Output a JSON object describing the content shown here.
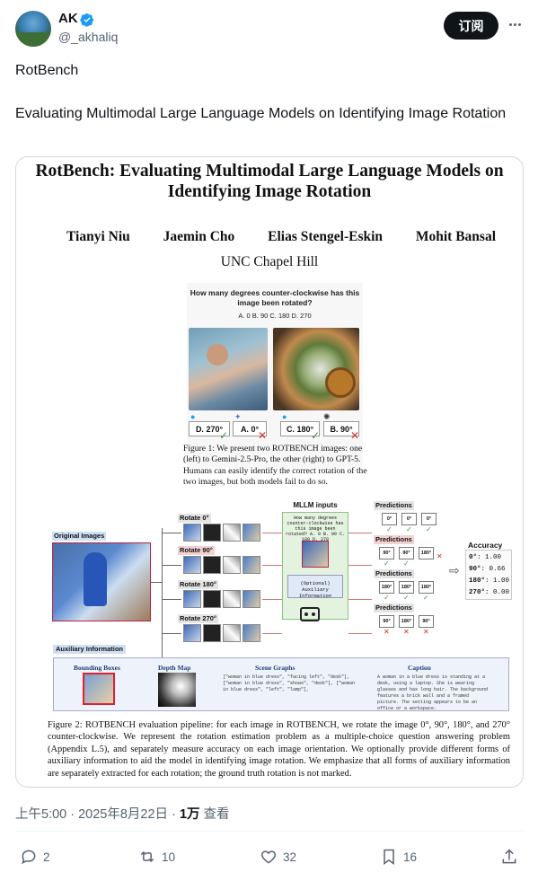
{
  "author": {
    "name": "AK",
    "handle": "@_akhaliq",
    "verified": true
  },
  "header": {
    "subscribe_label": "订阅",
    "more_icon": "more-horizontal-icon"
  },
  "tweet": {
    "line1": "RotBench",
    "line2": "Evaluating Multimodal Large Language Models on Identifying Image Rotation"
  },
  "paper": {
    "title": "RotBench: Evaluating Multimodal Large Language Models on Identifying Image Rotation",
    "authors": [
      "Tianyi Niu",
      "Jaemin Cho",
      "Elias Stengel-Eskin",
      "Mohit Bansal"
    ],
    "affiliation": "UNC Chapel Hill",
    "figure1": {
      "question": "How many degrees counter-clockwise has this image been rotated?",
      "options": "A. 0 B. 90 C. 180 D. 270",
      "answers": [
        "D. 270°",
        "A. 0°",
        "C. 180°",
        "B. 90°"
      ],
      "caption": "Figure 1: We present two ROTBENCH images: one (left) to Gemini-2.5-Pro, the other (right) to GPT-5. Humans can easily identify the correct rotation of the two images, but both models fail to do so."
    },
    "pipeline": {
      "original_images": "Original Images",
      "rotations": [
        "Rotate 0°",
        "Rotate 90°",
        "Rotate 180°",
        "Rotate 270°"
      ],
      "mllm_inputs": "MLLM inputs",
      "mllm_question": "How many degrees counter-clockwise has this image been rotated? A. 0 B. 90 C. 180 D. 270",
      "optional_aux": "(Optional) Auxiliary Information",
      "predictions_label": "Predictions",
      "predictions": [
        [
          "0°",
          "0°",
          "0°"
        ],
        [
          "90°",
          "90°",
          "180°"
        ],
        [
          "180°",
          "180°",
          "180°"
        ],
        [
          "90°",
          "180°",
          "90°"
        ]
      ],
      "accuracy_title": "Accuracy",
      "accuracy": [
        {
          "k": "0°",
          "v": ": 1.00"
        },
        {
          "k": "90°",
          "v": ": 0.66"
        },
        {
          "k": "180°",
          "v": ": 1.00"
        },
        {
          "k": "270°",
          "v": ": 0.00"
        }
      ],
      "aux_title": "Auxiliary Information",
      "aux_headers": [
        "Bounding Boxes",
        "Depth Map",
        "Scene Graphs",
        "Caption"
      ],
      "scene_graph": "[\"woman in blue dress\", \"facing left\", \"desk\"], [\"woman in blue dress\", \"shows\", \"desk\"], [\"woman in blue dress\", \"left\", \"lamp\"],",
      "caption_text": "A woman in a blue dress is standing at a desk, using a laptop. She is wearing glasses and has long hair. The background features a brick wall and a framed picture. The setting appears to be an office or a workspace."
    },
    "figure2_caption": "Figure 2: ROTBENCH evaluation pipeline: for each image in ROTBENCH, we rotate the image 0°, 90°, 180°, and 270° counter-clockwise. We represent the rotation estimation problem as a multiple-choice question answering problem (Appendix L.5), and separately measure accuracy on each image orientation. We optionally provide different forms of auxiliary information to aid the model in identifying image rotation. We emphasize that all forms of auxiliary information are separately extracted for each rotation; the ground truth rotation is not marked."
  },
  "meta": {
    "time": "上午5:00 · 2025年8月22日 · ",
    "views_count": "1万",
    "views_label": " 查看"
  },
  "actions": {
    "replies": "2",
    "reposts": "10",
    "likes": "32",
    "bookmarks": "16"
  },
  "colors": {
    "accent_verified": "#1d9bf0",
    "text_secondary": "#536471",
    "button_dark": "#0f1419"
  }
}
